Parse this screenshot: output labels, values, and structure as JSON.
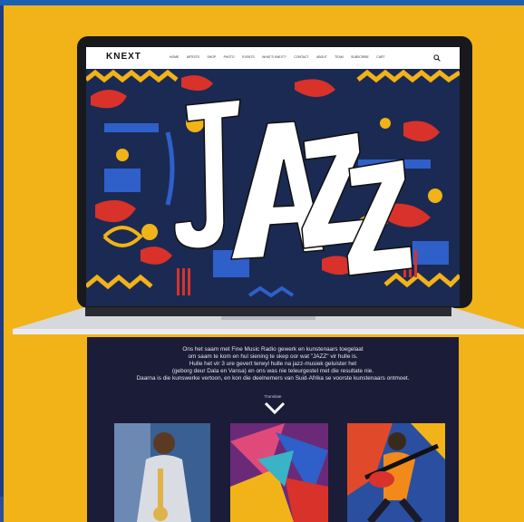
{
  "brand": {
    "logo": "KNEXT"
  },
  "nav": {
    "items": [
      "HOME",
      "ARTISTS",
      "SHOP",
      "PHOTO",
      "EVENTS",
      "WHAT'S KNEXT?",
      "CONTACT",
      "ABOUT",
      "TEAM",
      "SUBSCRIBE",
      "CART"
    ]
  },
  "hero": {
    "word": "JAZZ"
  },
  "content": {
    "paragraph_lines": [
      "Ons het saam met Fine Music Radio gewerk en kunstenaars toegelaat",
      "om saam te kom en hul siening te skep oor wat \"JAZZ\" vir hulle is.",
      "Hulle het vir 3 ure gevert terwyl hulle na jazz-musiek geluister het",
      "(geborg deur Dala en Vansa) en ons was nie teleurgestel met die resultate nie.",
      "Daarna is die kunswerke vertoon, en kon die deelnemers van Suid-Afrika se voorste kunstenaars ontmoet."
    ],
    "translate_label": "Translate"
  },
  "colors": {
    "background": "#f2b318",
    "site_bg": "#1b1c37",
    "accent_red": "#d8322b",
    "accent_blue": "#2f5fc9",
    "accent_yellow": "#f2b318"
  }
}
